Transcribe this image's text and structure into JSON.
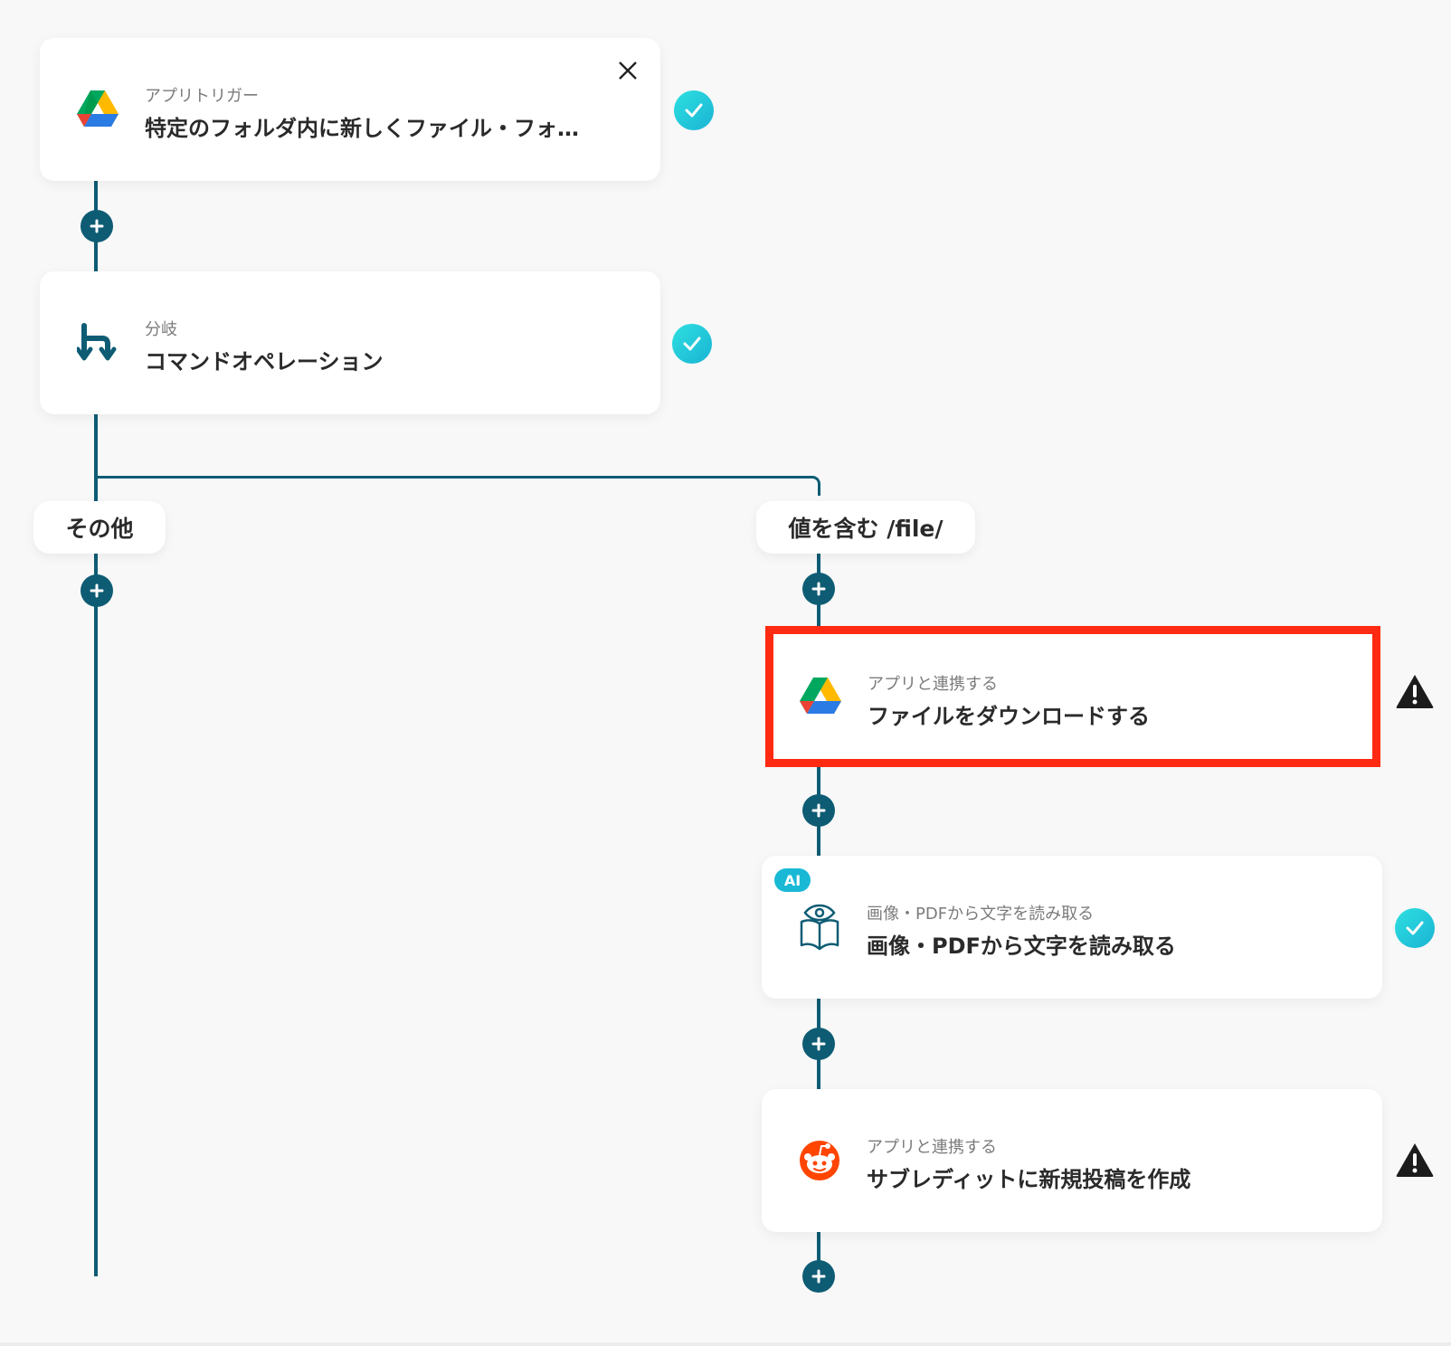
{
  "accent_color": "#0e5c74",
  "highlight_color": "#ff2a12",
  "check_color": "#1ab3d4",
  "nodes": {
    "trigger": {
      "subtitle": "アプリトリガー",
      "title": "特定のフォルダ内に新しくファイル・フォ…",
      "icon": "google-drive-icon",
      "status": "complete"
    },
    "branch": {
      "subtitle": "分岐",
      "title": "コマンドオペレーション",
      "icon": "branch-icon",
      "status": "complete"
    },
    "download": {
      "subtitle": "アプリと連携する",
      "title": "ファイルをダウンロードする",
      "icon": "google-drive-icon",
      "status": "warning"
    },
    "ocr": {
      "badge": "AI",
      "subtitle": "画像・PDFから文字を読み取る",
      "title": "画像・PDFから文字を読み取る",
      "icon": "ocr-book-icon",
      "status": "complete"
    },
    "reddit": {
      "subtitle": "アプリと連携する",
      "title": "サブレディットに新規投稿を作成",
      "icon": "reddit-icon",
      "status": "warning"
    }
  },
  "branches": {
    "left_label": "その他",
    "right_label": "値を含む /file/"
  }
}
